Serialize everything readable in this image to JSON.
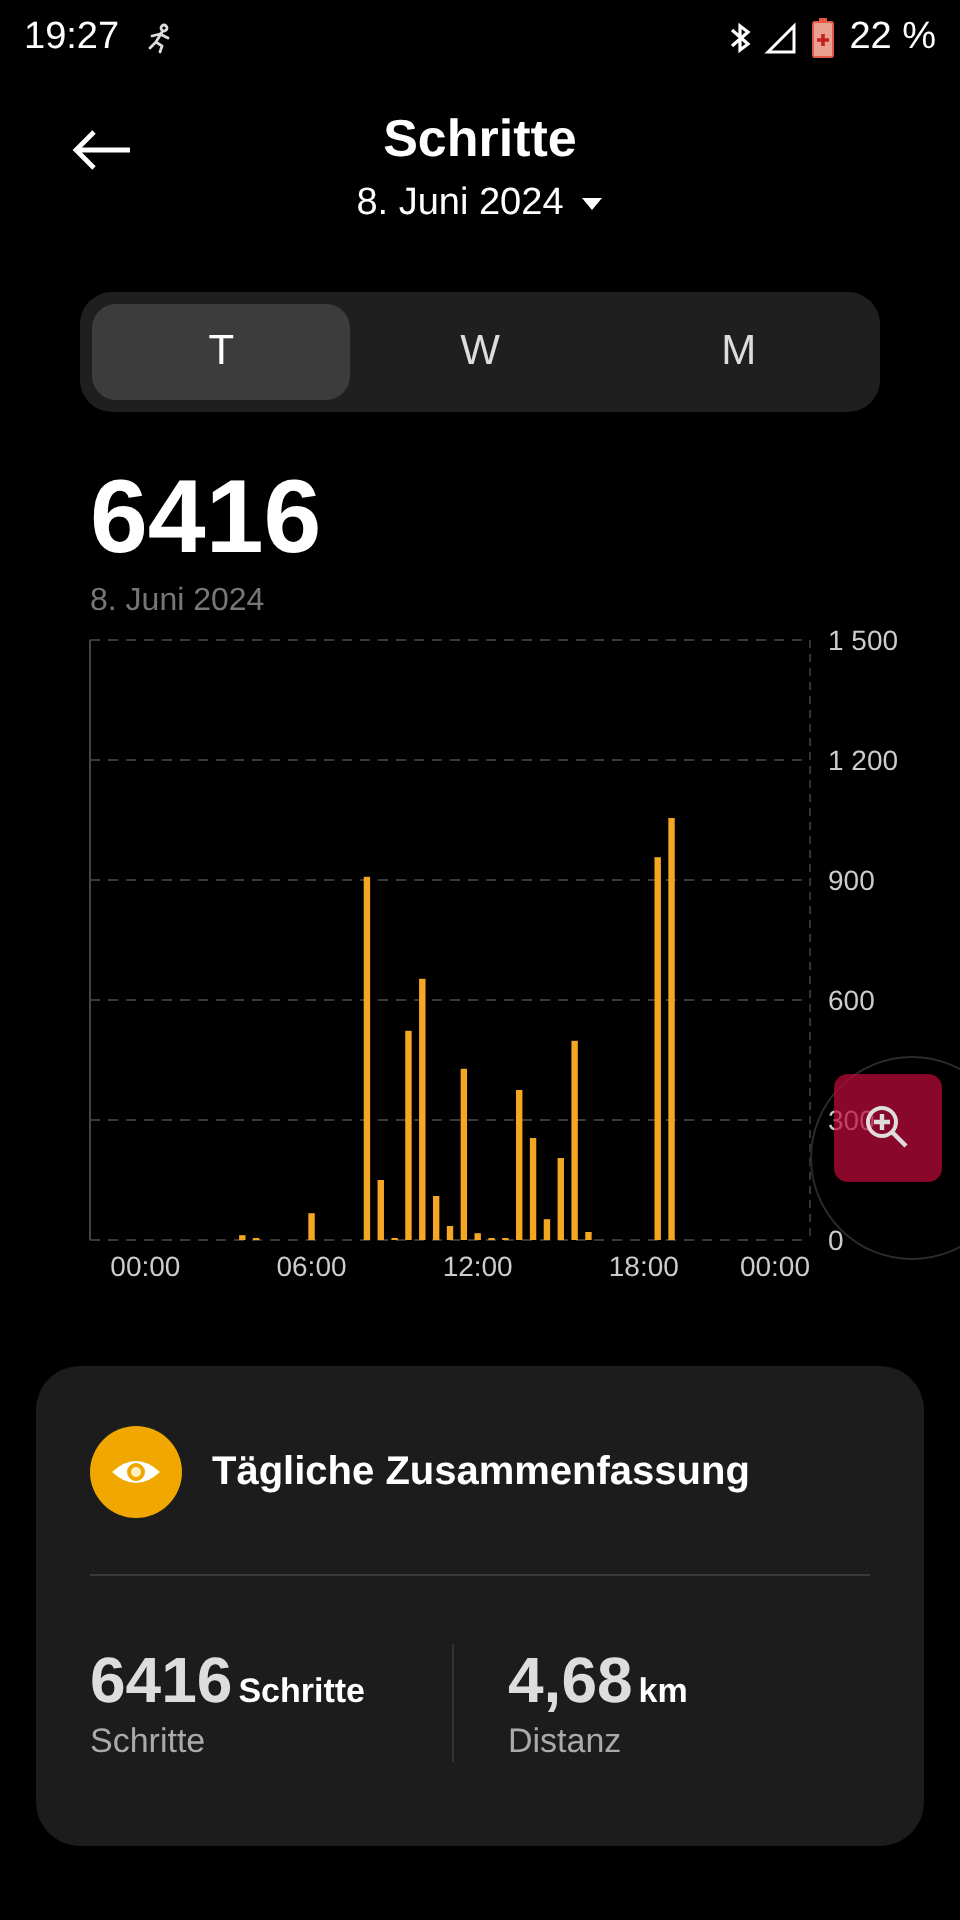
{
  "status_bar": {
    "time": "19:27",
    "battery": "22 %"
  },
  "header": {
    "title": "Schritte",
    "date": "8. Juni 2024"
  },
  "tabs": [
    {
      "label": "T",
      "selected": true
    },
    {
      "label": "W",
      "selected": false
    },
    {
      "label": "M",
      "selected": false
    }
  ],
  "total": {
    "value": "6416",
    "date": "8. Juni 2024"
  },
  "chart_data": {
    "type": "bar",
    "x": [
      0,
      0.5,
      1,
      1.5,
      2,
      2.5,
      3,
      3.5,
      4,
      4.5,
      5,
      5.5,
      6,
      6.5,
      7,
      7.5,
      8,
      8.5,
      9,
      9.5,
      10,
      10.5,
      11,
      11.5,
      12,
      12.5,
      13,
      13.5,
      14,
      14.5,
      15,
      15.5,
      16,
      16.5,
      17,
      17.5,
      18,
      18.5,
      19,
      19.5,
      20,
      20.5,
      21,
      21.5,
      22,
      22.5,
      23,
      23.5
    ],
    "grid": true,
    "xlim": [
      -2,
      24
    ],
    "series": [
      {
        "color": "#f5a623",
        "values": [
          0,
          0,
          0,
          0,
          0,
          0,
          0,
          12,
          5,
          0,
          0,
          0,
          67,
          0,
          0,
          0,
          908,
          150,
          5,
          523,
          653,
          110,
          35,
          428,
          17,
          5,
          5,
          375,
          255,
          52,
          205,
          498,
          20,
          0,
          0,
          0,
          0,
          957,
          1055,
          0,
          0,
          0,
          0,
          0,
          0,
          0,
          0,
          0
        ]
      }
    ],
    "ylim": [
      0,
      1500
    ],
    "yticks": [
      {
        "value": 0,
        "label": "0"
      },
      {
        "value": 300,
        "label": "300"
      },
      {
        "value": 600,
        "label": "600"
      },
      {
        "value": 900,
        "label": "900"
      },
      {
        "value": 1200,
        "label": "1 200"
      },
      {
        "value": 1500,
        "label": "1 500"
      }
    ],
    "xticks": [
      {
        "value": 0,
        "label": "00:00"
      },
      {
        "value": 6,
        "label": "06:00"
      },
      {
        "value": 12,
        "label": "12:00"
      },
      {
        "value": 18,
        "label": "18:00"
      },
      {
        "value": 24,
        "label": "00:00"
      }
    ]
  },
  "summary": {
    "title": "Tägliche Zusammenfassung",
    "stats": [
      {
        "value": "6416",
        "unit": "Schritte",
        "label": "Schritte"
      },
      {
        "value": "4,68",
        "unit": "km",
        "label": "Distanz"
      }
    ]
  }
}
